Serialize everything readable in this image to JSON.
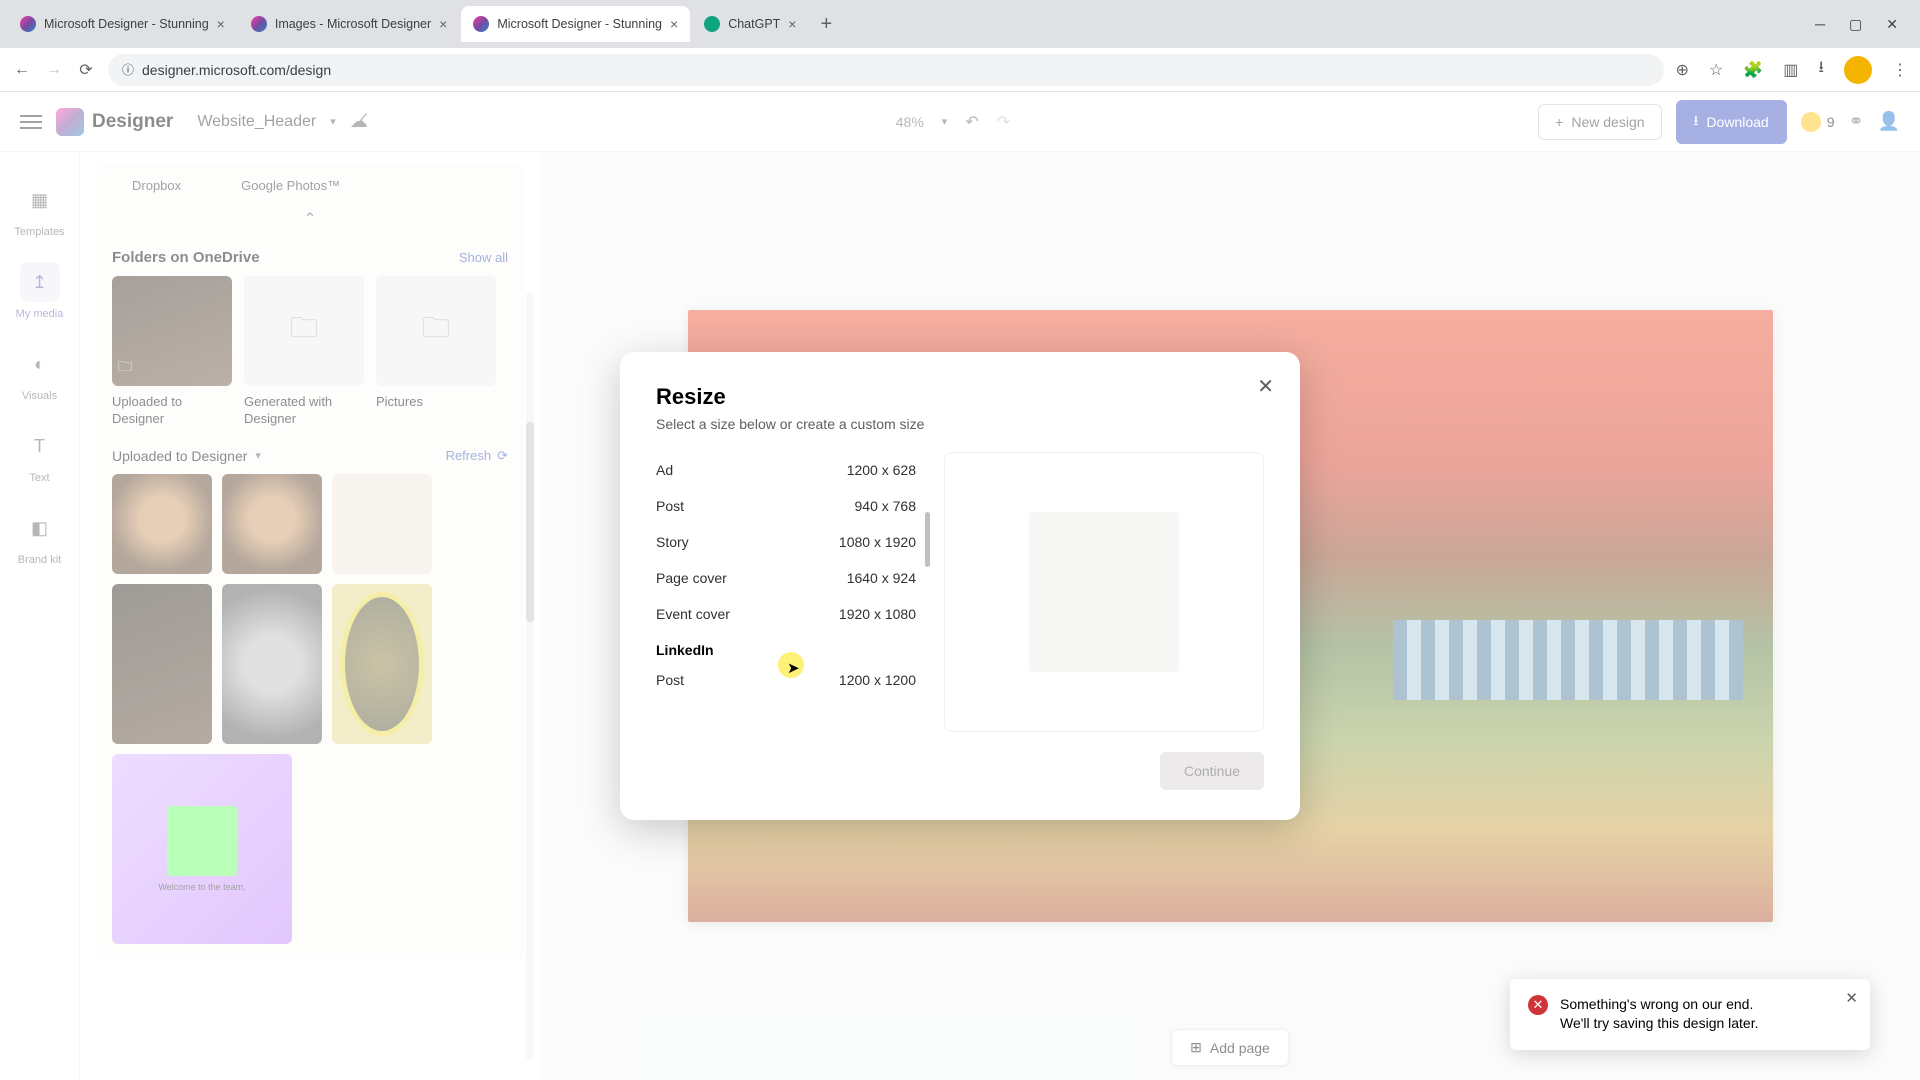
{
  "browser": {
    "tabs": [
      {
        "title": "Microsoft Designer - Stunning"
      },
      {
        "title": "Images - Microsoft Designer"
      },
      {
        "title": "Microsoft Designer - Stunning",
        "active": true
      },
      {
        "title": "ChatGPT"
      }
    ],
    "url": "designer.microsoft.com/design"
  },
  "header": {
    "app_name": "Designer",
    "doc_name": "Website_Header",
    "zoom": "48%",
    "new_design": "New design",
    "download": "Download",
    "coins": "9"
  },
  "rail": {
    "templates": "Templates",
    "my_media": "My media",
    "visuals": "Visuals",
    "text": "Text",
    "brand_kit": "Brand kit"
  },
  "panel": {
    "src_dropbox": "Dropbox",
    "src_google": "Google Photos™",
    "folders_title": "Folders on OneDrive",
    "show_all": "Show all",
    "folder1": "Uploaded to Designer",
    "folder2": "Generated with Designer",
    "folder3": "Pictures",
    "uploaded_title": "Uploaded to Designer",
    "refresh": "Refresh",
    "card_welcome": "Welcome to the team,"
  },
  "modal": {
    "title": "Resize",
    "subtitle": "Select a size below or create a custom size",
    "sizes": [
      {
        "label": "Ad",
        "dim": "1200 x 628"
      },
      {
        "label": "Post",
        "dim": "940 x 768"
      },
      {
        "label": "Story",
        "dim": "1080 x 1920"
      },
      {
        "label": "Page cover",
        "dim": "1640 x 924"
      },
      {
        "label": "Event cover",
        "dim": "1920 x 1080"
      }
    ],
    "category": "LinkedIn",
    "sizes2": [
      {
        "label": "Post",
        "dim": "1200 x 1200"
      }
    ],
    "continue": "Continue"
  },
  "toast": {
    "line1": "Something's wrong on our end.",
    "line2": "We'll try saving this design later."
  },
  "add_page": "Add page"
}
